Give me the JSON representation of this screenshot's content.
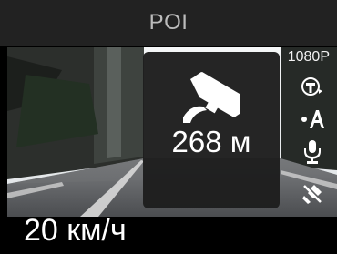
{
  "header": {
    "title": "POI"
  },
  "poi_alert": {
    "icon": "speed-camera-icon",
    "distance": "268 м"
  },
  "status": {
    "resolution": "1080P",
    "icons": [
      "lens-auto-icon",
      "auto-exposure-icon",
      "microphone-icon",
      "gps-off-icon"
    ]
  },
  "footer": {
    "speed": "20 км/ч"
  },
  "colors": {
    "title_bar": "#222222",
    "title_text": "#bcbcbc",
    "panel": "#1e1e1e",
    "text": "#ffffff"
  }
}
